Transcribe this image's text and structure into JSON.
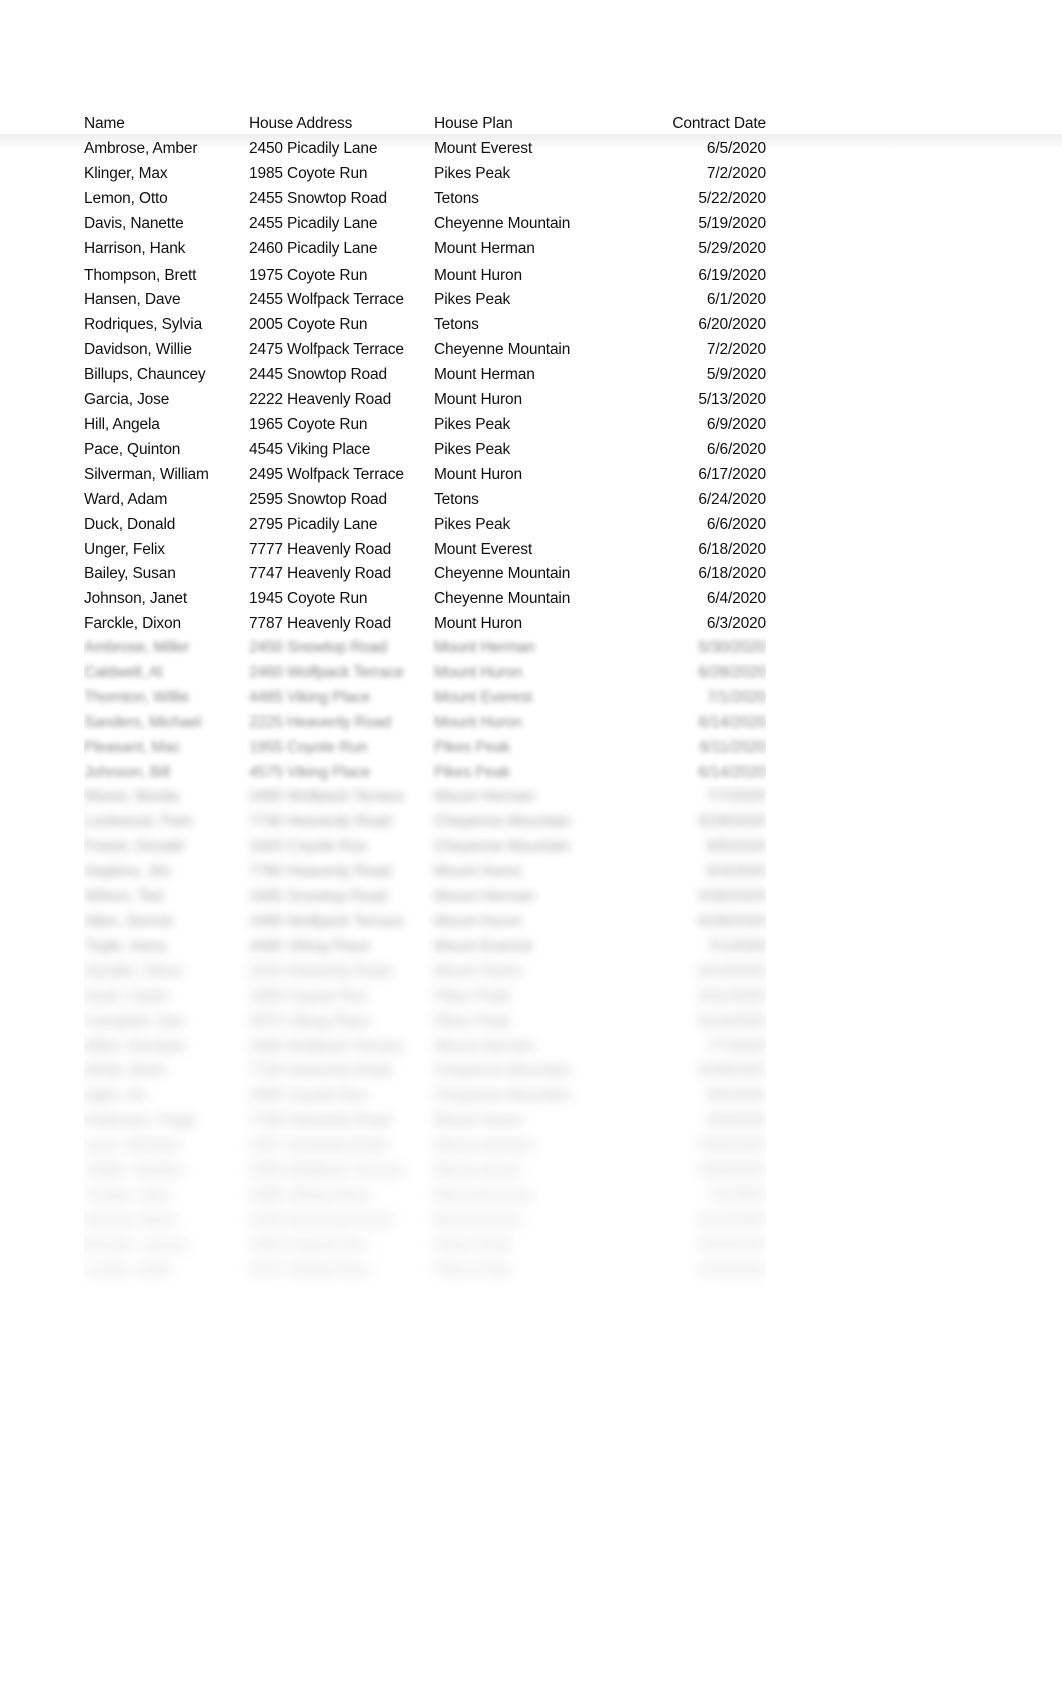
{
  "document": {
    "type": "spreadsheet-table",
    "background_color": "#ffffff",
    "text_color": "#111111",
    "blurred_text_color": "#6f6f6f"
  },
  "table": {
    "columns": [
      {
        "key": "name",
        "label": "Name",
        "align": "left"
      },
      {
        "key": "address",
        "label": "House Address",
        "align": "left"
      },
      {
        "key": "plan",
        "label": "House Plan",
        "align": "left"
      },
      {
        "key": "date",
        "label": "Contract Date",
        "align": "right"
      }
    ],
    "headers": {
      "name": "Name",
      "address": "House Address",
      "plan": "House Plan",
      "date": "Contract Date"
    },
    "rows": [
      {
        "name": "Ambrose,  Amber",
        "address": "2450 Picadily Lane",
        "plan": "Mount Everest",
        "date": "6/5/2020"
      },
      {
        "name": "Klinger, Max",
        "address": "1985 Coyote Run",
        "plan": "Pikes Peak",
        "date": "7/2/2020"
      },
      {
        "name": "Lemon,  Otto",
        "address": "2455 Snowtop Road",
        "plan": "Tetons",
        "date": "5/22/2020"
      },
      {
        "name": "Davis,  Nanette",
        "address": "2455 Picadily Lane",
        "plan": "Cheyenne Mountain",
        "date": "5/19/2020"
      },
      {
        "name": "Harrison,  Hank",
        "address": "2460 Picadily Lane",
        "plan": "Mount Herman",
        "date": "5/29/2020"
      },
      {
        "name": "Thompson,  Brett",
        "address": "1975 Coyote Run",
        "plan": "Mount Huron",
        "date": "6/19/2020"
      },
      {
        "name": "Hansen, Dave",
        "address": "2455 Wolfpack Terrace",
        "plan": "Pikes Peak",
        "date": "6/1/2020"
      },
      {
        "name": "Rodriques,  Sylvia",
        "address": "2005 Coyote Run",
        "plan": "Tetons",
        "date": "6/20/2020"
      },
      {
        "name": "Davidson,  Willie",
        "address": "2475 Wolfpack Terrace",
        "plan": "Cheyenne Mountain",
        "date": "7/2/2020"
      },
      {
        "name": "Billups,  Chauncey",
        "address": "2445 Snowtop Road",
        "plan": "Mount Herman",
        "date": "5/9/2020"
      },
      {
        "name": "Garcia,  Jose",
        "address": "2222 Heavenly Road",
        "plan": "Mount Huron",
        "date": "5/13/2020"
      },
      {
        "name": "Hill,  Angela",
        "address": "1965 Coyote Run",
        "plan": "Pikes Peak",
        "date": "6/9/2020"
      },
      {
        "name": "Pace,  Quinton",
        "address": "4545 Viking Place",
        "plan": "Pikes Peak",
        "date": "6/6/2020"
      },
      {
        "name": "Silverman, William",
        "address": "2495 Wolfpack Terrace",
        "plan": "Mount Huron",
        "date": "6/17/2020"
      },
      {
        "name": "Ward, Adam",
        "address": "2595 Snowtop Road",
        "plan": "Tetons",
        "date": "6/24/2020"
      },
      {
        "name": "Duck,  Donald",
        "address": "2795 Picadily Lane",
        "plan": "Pikes Peak",
        "date": "6/6/2020"
      },
      {
        "name": "Unger,  Felix",
        "address": "7777 Heavenly Road",
        "plan": "Mount Everest",
        "date": "6/18/2020"
      },
      {
        "name": "Bailey,  Susan",
        "address": "7747 Heavenly Road",
        "plan": "Cheyenne Mountain",
        "date": "6/18/2020"
      },
      {
        "name": "Johnson,  Janet",
        "address": "1945 Coyote Run",
        "plan": "Cheyenne Mountain",
        "date": "6/4/2020"
      },
      {
        "name": "Farckle,  Dixon",
        "address": "7787 Heavenly Road",
        "plan": "Mount Huron",
        "date": "6/3/2020"
      }
    ],
    "obscured_rows_note": "rows below are blurred out in the preview and not legible",
    "blurred_rows": [
      {
        "name": "Ambrose,  Miller",
        "address": "2450 Snowtop Road",
        "plan": "Mount Herman",
        "date": "5/30/2020"
      },
      {
        "name": "Caldwell,  Al",
        "address": "2460 Wolfpack Terrace",
        "plan": "Mount Huron",
        "date": "6/28/2020"
      },
      {
        "name": "Thornton,  Willie",
        "address": "4485 Viking Place",
        "plan": "Mount Everest",
        "date": "7/1/2020"
      },
      {
        "name": "Sanders,  Michael",
        "address": "2225 Heavenly Road",
        "plan": "Mount Huron",
        "date": "6/14/2020"
      },
      {
        "name": "Pleasant,  Mac",
        "address": "1955 Coyote Run",
        "plan": "Pikes Peak",
        "date": "6/11/2020"
      },
      {
        "name": "Johnson,  Bill",
        "address": "4575 Viking Place",
        "plan": "Pikes Peak",
        "date": "6/14/2020"
      },
      {
        "name": "Moore,  Bonita",
        "address": "2465 Wolfpack Terrace",
        "plan": "Mount Herman",
        "date": "7/7/2020"
      },
      {
        "name": "Lockwood,  Pam",
        "address": "7740 Heavenly Road",
        "plan": "Cheyenne Mountain",
        "date": "6/28/2020"
      },
      {
        "name": "Freest,  Donald",
        "address": "1920 Coyote Run",
        "plan": "Cheyenne Mountain",
        "date": "6/5/2020"
      },
      {
        "name": "Hopkins,  Jim",
        "address": "7780 Heavenly Road",
        "plan": "Mount Huron",
        "date": "6/3/2020"
      },
      {
        "name": "Wilson,  Ted",
        "address": "2485 Snowtop Road",
        "plan": "Mount Herman",
        "date": "5/30/2020"
      },
      {
        "name": "Allen,  Dennis",
        "address": "2480 Wolfpack Terrace",
        "plan": "Mount Huron",
        "date": "6/28/2020"
      },
      {
        "name": "Triple,  Harry",
        "address": "4485 Viking Place",
        "plan": "Mount Everest",
        "date": "7/1/2020"
      },
      {
        "name": "Sandler,  Steve",
        "address": "2215 Heavenly Road",
        "plan": "Mount Huron",
        "date": "6/14/2020"
      },
      {
        "name": "Scott,  Carter",
        "address": "1950 Coyote Run",
        "plan": "Pikes Peak",
        "date": "6/11/2020"
      },
      {
        "name": "Campbell,  Dan",
        "address": "4575 Viking Place",
        "plan": "Pikes Peak",
        "date": "6/14/2020"
      },
      {
        "name": "Miller,  Ronalda",
        "address": "2480 Wolfpack Terrace",
        "plan": "Mount Herman",
        "date": "7/7/2020"
      },
      {
        "name": "White,  Brian",
        "address": "7730 Heavenly Road",
        "plan": "Cheyenne Mountain",
        "date": "6/28/2020"
      },
      {
        "name": "Agler,  Art",
        "address": "1955 Coyote Run",
        "plan": "Cheyenne Mountain",
        "date": "6/5/2020"
      },
      {
        "name": "Anderson,  Paige",
        "address": "7780 Heavenly Road",
        "plan": "Mount Huron",
        "date": "6/3/2020"
      },
      {
        "name": "Lane,  Michael",
        "address": "2457 Snowtop Road",
        "plan": "Mount Herman",
        "date": "5/30/2020"
      },
      {
        "name": "Triplet,  Sandra",
        "address": "2465 Wolfpack Terrace",
        "plan": "Mount Huron",
        "date": "6/28/2020"
      },
      {
        "name": "Tucker,  John",
        "address": "4485 Viking Place",
        "plan": "Mount Everest",
        "date": "7/1/2020"
      },
      {
        "name": "Harvey,  Mack",
        "address": "2230 Heavenly Road",
        "plan": "Mount Huron",
        "date": "6/14/2020"
      },
      {
        "name": "Brooks,  Lauren",
        "address": "1955 Coyote Run",
        "plan": "Pikes Peak",
        "date": "6/11/2020"
      },
      {
        "name": "Cooke,  Keith",
        "address": "4575 Viking Place",
        "plan": "Pikes Peak",
        "date": "6/14/2020"
      }
    ]
  }
}
